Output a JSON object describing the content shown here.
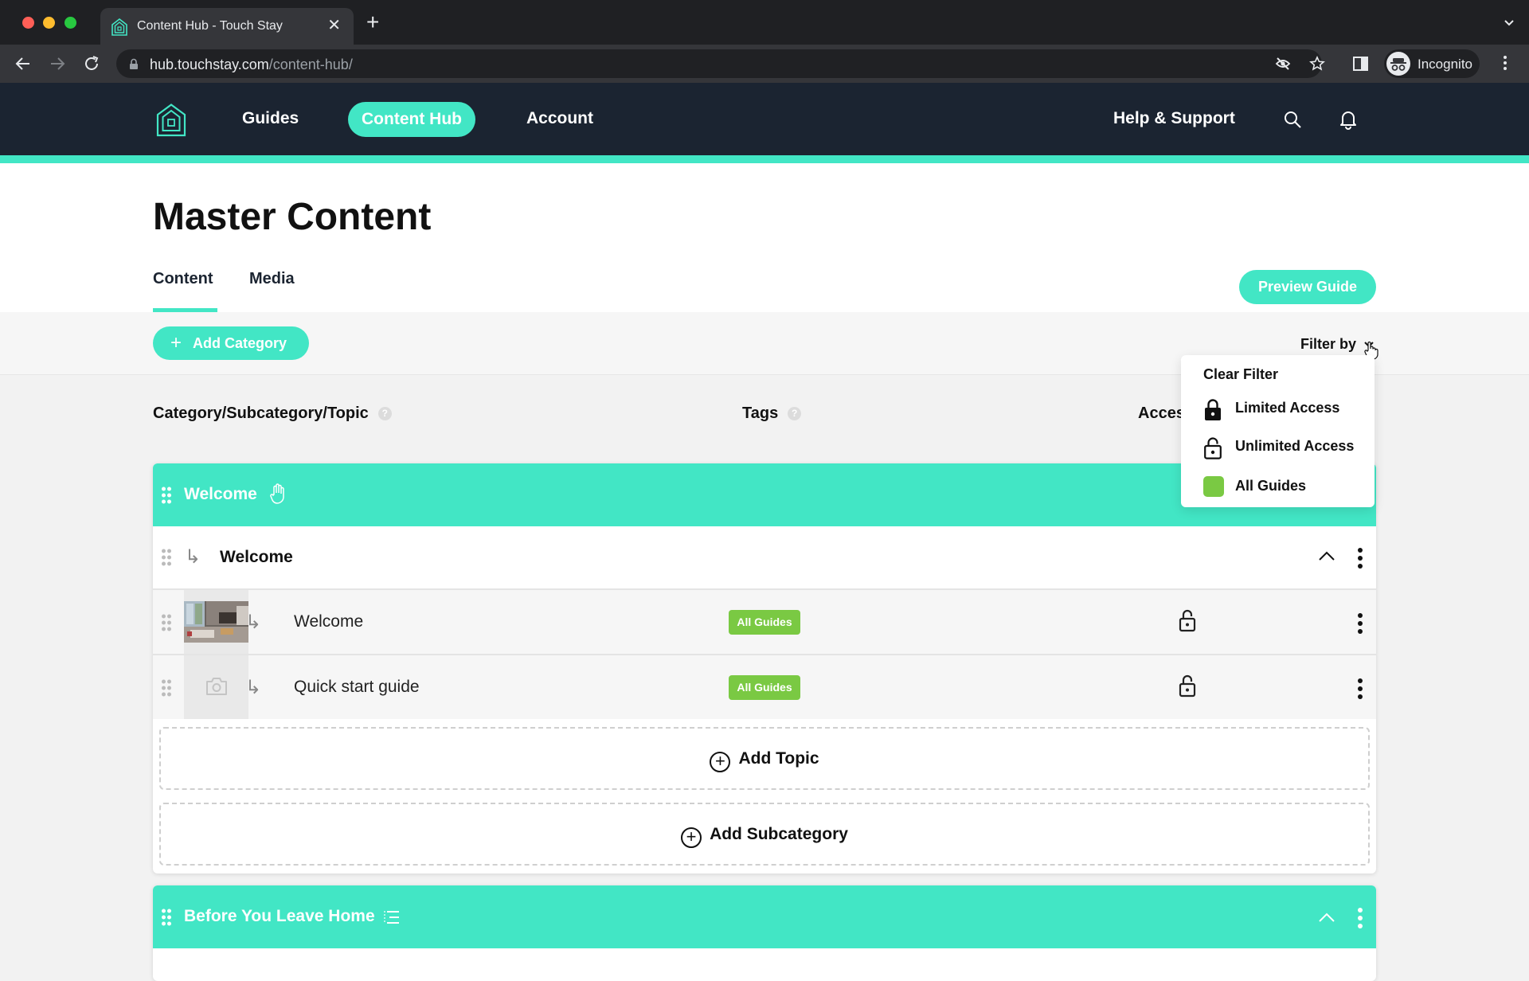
{
  "browser": {
    "tab_title": "Content Hub - Touch Stay",
    "url_host": "hub.touchstay.com",
    "url_path": "/content-hub/",
    "profile_label": "Incognito"
  },
  "appnav": {
    "items": [
      {
        "label": "Guides",
        "active": false
      },
      {
        "label": "Content Hub",
        "active": true
      },
      {
        "label": "Account",
        "active": false
      }
    ],
    "help_label": "Help & Support"
  },
  "colors": {
    "accent": "#42e6c5",
    "nav_bg": "#1b2431",
    "tag_green": "#7ac943"
  },
  "page": {
    "title": "Master Content",
    "tabs": [
      {
        "label": "Content",
        "active": true
      },
      {
        "label": "Media",
        "active": false
      }
    ],
    "preview_button": "Preview Guide",
    "add_category_button": "Add Category",
    "filter_label": "Filter by"
  },
  "columns": {
    "category": "Category/Subcategory/Topic",
    "tags": "Tags",
    "access": "Access"
  },
  "filter_menu": {
    "items": [
      {
        "label": "Clear Filter",
        "icon": "none"
      },
      {
        "label": "Limited Access",
        "icon": "lock-closed-icon"
      },
      {
        "label": "Unlimited Access",
        "icon": "lock-open-icon"
      },
      {
        "label": "All Guides",
        "icon": "green-swatch"
      }
    ]
  },
  "categories": [
    {
      "name": "Welcome",
      "subcategories": [
        {
          "name": "Welcome",
          "topics": [
            {
              "name": "Welcome",
              "tag": "All Guides",
              "access": "unlimited",
              "has_image": true
            },
            {
              "name": "Quick start guide",
              "tag": "All Guides",
              "access": "unlimited",
              "has_image": false
            }
          ]
        }
      ],
      "add_topic_label": "Add Topic",
      "add_subcategory_label": "Add Subcategory"
    },
    {
      "name": "Before You Leave Home"
    }
  ]
}
